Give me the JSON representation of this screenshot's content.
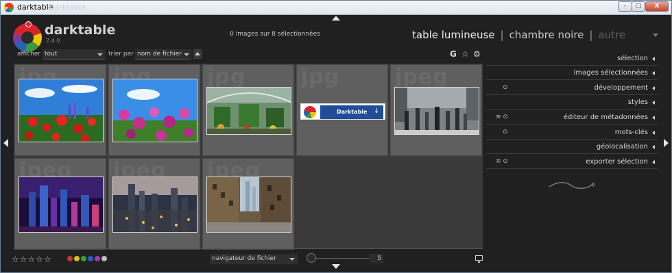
{
  "window": {
    "title": "darktable",
    "ghost_title": "Darktable",
    "buttons": {
      "minimize": "–",
      "maximize": "□",
      "close": "X"
    }
  },
  "app": {
    "name": "darktable",
    "version": "2.4.0"
  },
  "header": {
    "selection_info": "0 images sur 8 sélectionnées",
    "views": {
      "lighttable": "table lumineuse",
      "sep1": "|",
      "darkroom": "chambre noire",
      "sep2": "|",
      "other": "autre"
    }
  },
  "filter": {
    "show_label": "afficher",
    "show_value": "tout",
    "sort_label": "trier par",
    "sort_value": "nom de fichier",
    "icons": {
      "grouping": "G",
      "star": "☆",
      "gear": "⚙"
    }
  },
  "thumbnails": [
    {
      "ext": "jpg",
      "subject": "poppies-field"
    },
    {
      "ext": "jpg",
      "subject": "cosmos-flowers"
    },
    {
      "ext": "jpg",
      "subject": "garden-greenhouse"
    },
    {
      "ext": "jpg",
      "subject": "darktable-banner",
      "banner_text": "Darktable"
    },
    {
      "ext": "jpeg",
      "subject": "street-crowd"
    },
    {
      "ext": "jpeg",
      "subject": "night-skyline"
    },
    {
      "ext": "jpeg",
      "subject": "city-dusk"
    },
    {
      "ext": "jpeg",
      "subject": "street-buildings"
    }
  ],
  "right_panel": {
    "modules": [
      {
        "label": "sélection",
        "icons": ""
      },
      {
        "label": "images sélectionnées",
        "icons": ""
      },
      {
        "label": "développement",
        "icons": "⊙"
      },
      {
        "label": "styles",
        "icons": ""
      },
      {
        "label": "éditeur de métadonnées",
        "icons": "≡ ⊙"
      },
      {
        "label": "mots-clés",
        "icons": "⊙"
      },
      {
        "label": "géolocalisation",
        "icons": ""
      },
      {
        "label": "exporter sélection",
        "icons": "≡ ⊙"
      }
    ]
  },
  "footer": {
    "stars": "☆☆☆☆☆",
    "color_labels": [
      "#c0392b",
      "#d4c21c",
      "#3aa03a",
      "#2c5ec7",
      "#9b3fb5",
      "#bdbdbd"
    ],
    "navigator": "navigateur de fichier",
    "zoom_value": "5"
  }
}
